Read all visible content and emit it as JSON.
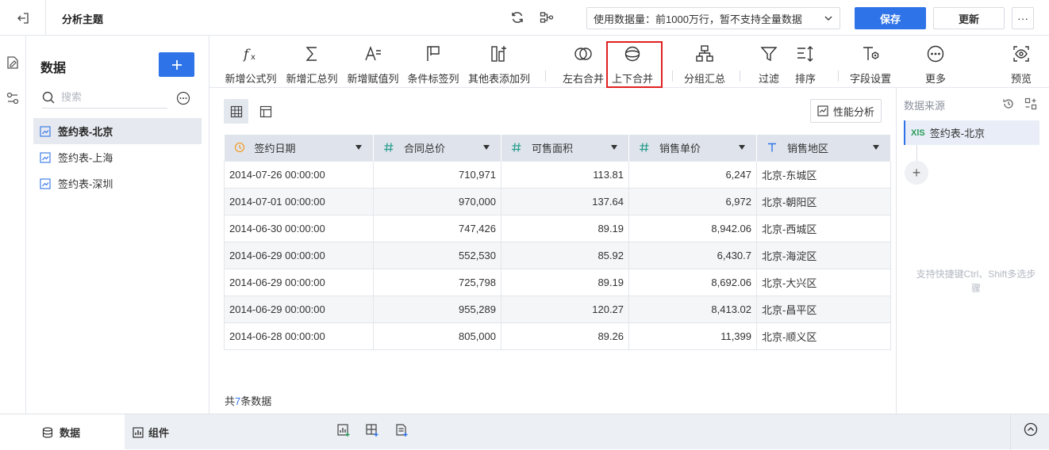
{
  "topbar": {
    "title": "分析主题",
    "dataset_select": "使用数据量：前1000万行，暂不支持全量数据",
    "save_label": "保存",
    "update_label": "更新",
    "more_label": "···"
  },
  "datapanel": {
    "title": "数据",
    "search_placeholder": "搜索",
    "items": [
      {
        "label": "签约表-北京",
        "active": true
      },
      {
        "label": "签约表-上海",
        "active": false
      },
      {
        "label": "签约表-深圳",
        "active": false
      }
    ]
  },
  "toolbar": {
    "items": [
      {
        "label": "新增公式列",
        "icon": "formula-icon"
      },
      {
        "label": "新增汇总列",
        "icon": "sigma-icon"
      },
      {
        "label": "新增赋值列",
        "icon": "assign-icon"
      },
      {
        "label": "条件标签列",
        "icon": "flag-icon"
      },
      {
        "label": "其他表添加列",
        "icon": "add-column-icon"
      },
      {
        "label": "左右合并",
        "icon": "horizontal-merge-icon"
      },
      {
        "label": "上下合并",
        "icon": "vertical-merge-icon"
      },
      {
        "label": "分组汇总",
        "icon": "group-summary-icon"
      },
      {
        "label": "过滤",
        "icon": "filter-icon"
      },
      {
        "label": "排序",
        "icon": "sort-icon"
      },
      {
        "label": "字段设置",
        "icon": "field-settings-icon"
      },
      {
        "label": "更多",
        "icon": "more-circle-icon"
      },
      {
        "label": "预览",
        "icon": "preview-icon"
      }
    ]
  },
  "main": {
    "perf_label": "性能分析",
    "columns": [
      {
        "name": "签约日期",
        "type": "date"
      },
      {
        "name": "合同总价",
        "type": "number"
      },
      {
        "name": "可售面积",
        "type": "number"
      },
      {
        "name": "销售单价",
        "type": "number"
      },
      {
        "name": "销售地区",
        "type": "text"
      }
    ],
    "rows": [
      [
        "2014-07-26 00:00:00",
        "710,971",
        "113.81",
        "6,247",
        "北京-东城区"
      ],
      [
        "2014-07-01 00:00:00",
        "970,000",
        "137.64",
        "6,972",
        "北京-朝阳区"
      ],
      [
        "2014-06-30 00:00:00",
        "747,426",
        "89.19",
        "8,942.06",
        "北京-西城区"
      ],
      [
        "2014-06-29 00:00:00",
        "552,530",
        "85.92",
        "6,430.7",
        "北京-海淀区"
      ],
      [
        "2014-06-29 00:00:00",
        "725,798",
        "89.19",
        "8,692.06",
        "北京-大兴区"
      ],
      [
        "2014-06-29 00:00:00",
        "955,289",
        "120.27",
        "8,413.02",
        "北京-昌平区"
      ],
      [
        "2014-06-28 00:00:00",
        "805,000",
        "89.26",
        "11,399",
        "北京-顺义区"
      ]
    ],
    "count_prefix": "共",
    "count_value": "7",
    "count_suffix": "条数据"
  },
  "rightpanel": {
    "title": "数据来源",
    "source_badge": "XlS",
    "source_label": "签约表-北京",
    "add_step": "+",
    "hint": "支持快捷键Ctrl、Shift多选步骤"
  },
  "bottombar": {
    "tab_data": "数据",
    "tab_component": "组件"
  },
  "colors": {
    "primary": "#2f73e8",
    "highlight_border": "#e02020",
    "header_bg": "#dfe4ec",
    "date_icon": "#f0a030",
    "number_icon": "#2a9d8f",
    "text_icon": "#2f73e8"
  }
}
